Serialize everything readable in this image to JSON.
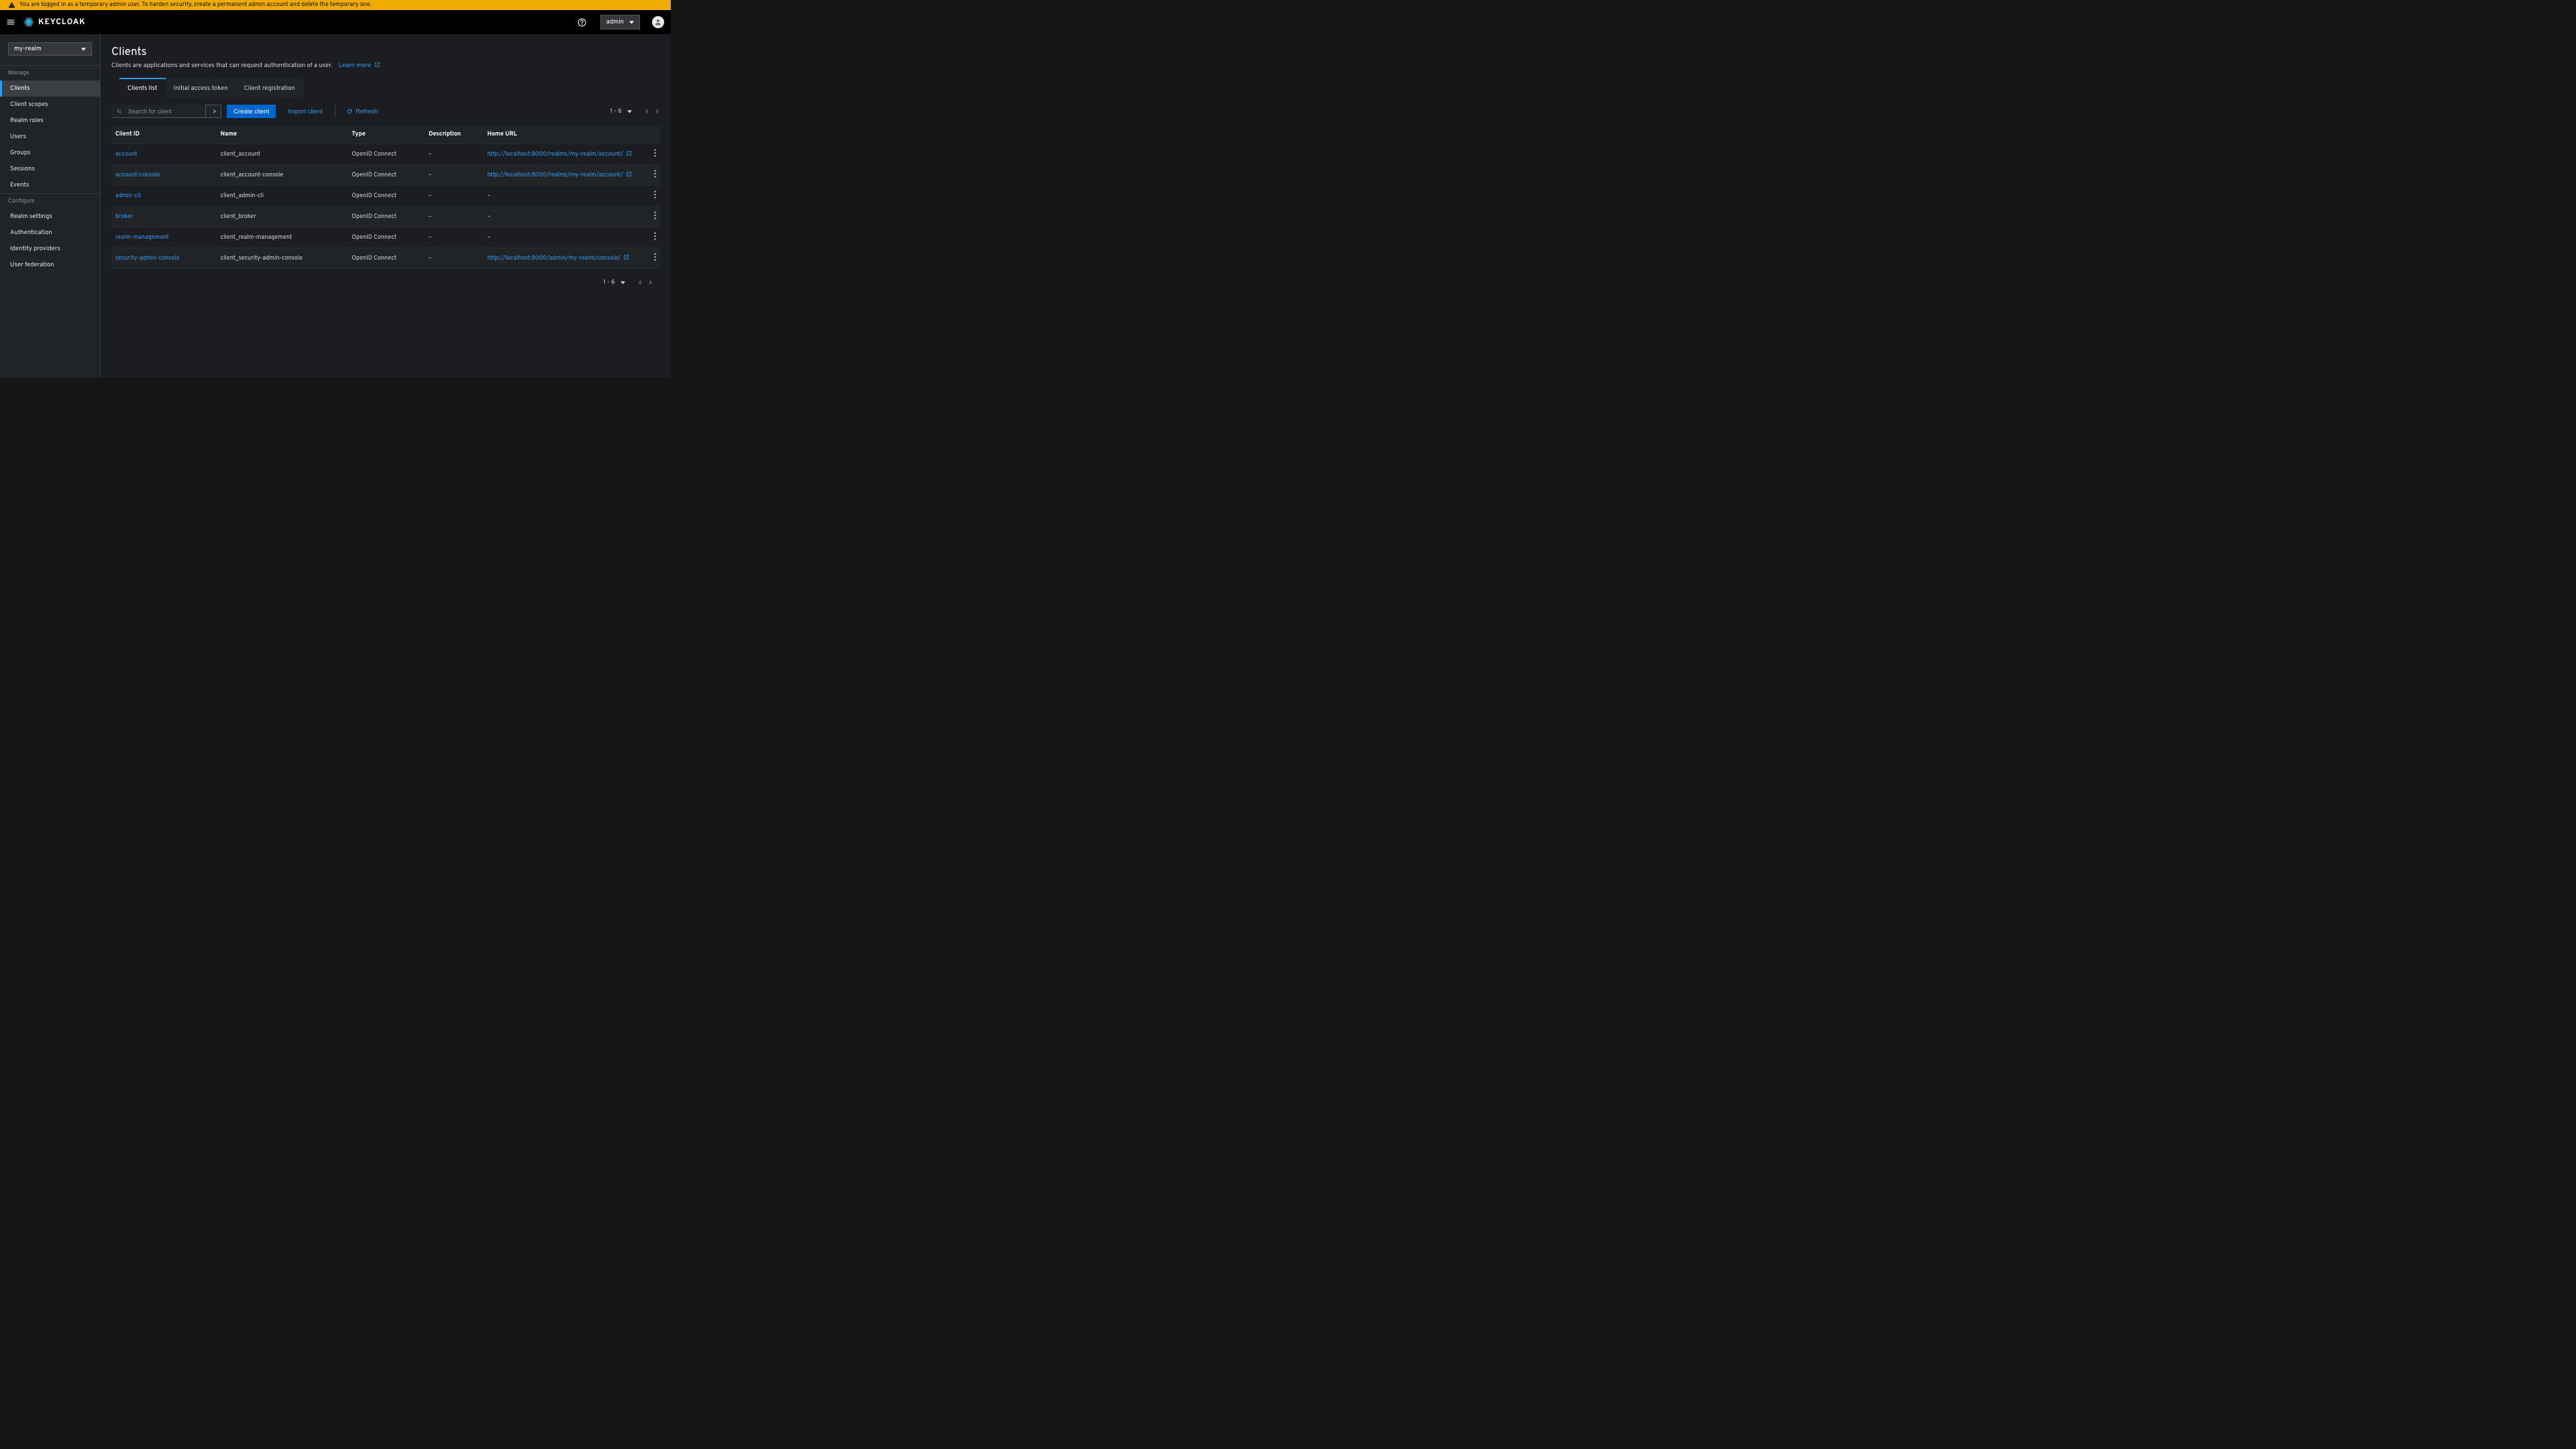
{
  "warning": "You are logged in as a temporary admin user. To harden security, create a permanent admin account and delete the temporary one.",
  "logo_text": "KEYCLOAK",
  "user_menu_label": "admin",
  "realm_selected": "my-realm",
  "sidebar": {
    "manage_label": "Manage",
    "configure_label": "Configure",
    "manage": [
      "Clients",
      "Client scopes",
      "Realm roles",
      "Users",
      "Groups",
      "Sessions",
      "Events"
    ],
    "configure": [
      "Realm settings",
      "Authentication",
      "Identity providers",
      "User federation"
    ],
    "active": "Clients"
  },
  "page": {
    "title": "Clients",
    "description": "Clients are applications and services that can request authentication of a user.",
    "learn_more": "Learn more"
  },
  "tabs": [
    "Clients list",
    "Initial access token",
    "Client registration"
  ],
  "toolbar": {
    "search_placeholder": "Search for client",
    "create_label": "Create client",
    "import_label": "Import client",
    "refresh_label": "Refresh",
    "page_range": "1 - 6"
  },
  "columns": [
    "Client ID",
    "Name",
    "Type",
    "Description",
    "Home URL"
  ],
  "rows": [
    {
      "id": "account",
      "name": "client_account",
      "type": "OpenID Connect",
      "desc": "–",
      "home": "http://localhost:8000/realms/my-realm/account/"
    },
    {
      "id": "account-console",
      "name": "client_account-console",
      "type": "OpenID Connect",
      "desc": "–",
      "home": "http://localhost:8000/realms/my-realm/account/"
    },
    {
      "id": "admin-cli",
      "name": "client_admin-cli",
      "type": "OpenID Connect",
      "desc": "–",
      "home": "–"
    },
    {
      "id": "broker",
      "name": "client_broker",
      "type": "OpenID Connect",
      "desc": "–",
      "home": "–"
    },
    {
      "id": "realm-management",
      "name": "client_realm-management",
      "type": "OpenID Connect",
      "desc": "–",
      "home": "–"
    },
    {
      "id": "security-admin-console",
      "name": "client_security-admin-console",
      "type": "OpenID Connect",
      "desc": "–",
      "home": "http://localhost:8000/admin/my-realm/console/"
    }
  ],
  "dash": "–"
}
